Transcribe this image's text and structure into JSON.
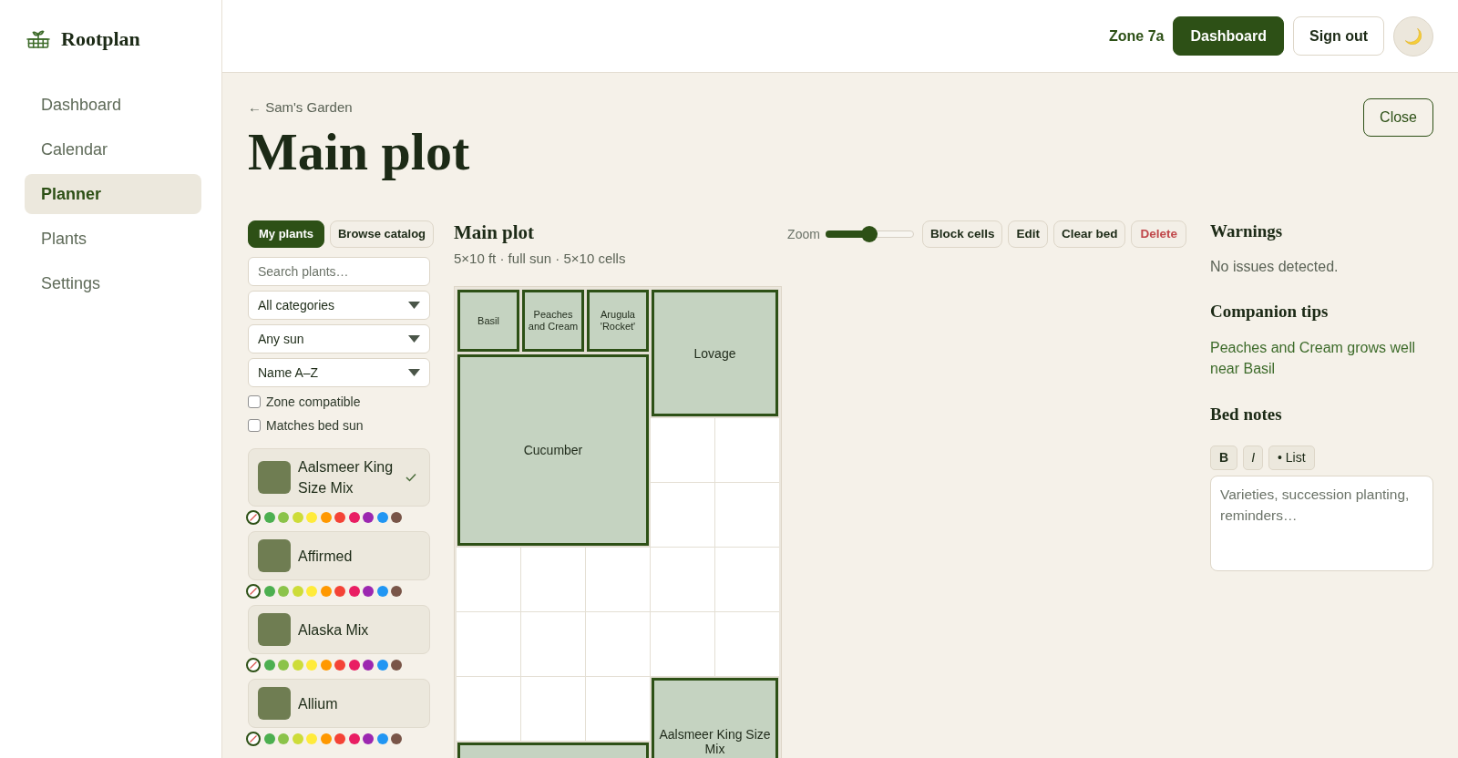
{
  "sidebar": {
    "brand": "Rootplan",
    "items": [
      {
        "label": "Dashboard",
        "selected": false
      },
      {
        "label": "Calendar",
        "selected": false
      },
      {
        "label": "Planner",
        "selected": true
      },
      {
        "label": "Plants",
        "selected": false
      },
      {
        "label": "Settings",
        "selected": false
      }
    ]
  },
  "header": {
    "zone": "Zone 7a",
    "buttons": [
      {
        "label": "Dashboard",
        "kind": "primary"
      },
      {
        "label": "Sign out",
        "kind": "outline"
      }
    ]
  },
  "page": {
    "breadcrumb": "← Sam's Garden",
    "title": "Main plot",
    "close_button": "Close"
  },
  "plant_panel": {
    "tabs": [
      {
        "label": "My plants",
        "selected": true
      },
      {
        "label": "Browse catalog",
        "selected": false
      }
    ],
    "search": {
      "placeholder": "Search plants…"
    },
    "filters": [
      {
        "value": "All categories"
      },
      {
        "value": "Any sun"
      },
      {
        "value": "Name A–Z"
      }
    ],
    "checkboxes": [
      {
        "label": "Zone compatible",
        "checked": false
      },
      {
        "label": "Matches bed sun",
        "checked": false
      }
    ],
    "plants": [
      {
        "name": "Aalsmeer King Size Mix",
        "selected": true,
        "swatches": [
          {
            "kind": "none",
            "selected": true
          },
          {
            "kind": "color",
            "color": "#4caf50",
            "selected": false
          },
          {
            "kind": "color",
            "color": "#8bc34a",
            "selected": false
          },
          {
            "kind": "color",
            "color": "#cddc39",
            "selected": false
          },
          {
            "kind": "color",
            "color": "#ffeb3b",
            "selected": false
          },
          {
            "kind": "color",
            "color": "#ff9800",
            "selected": false
          },
          {
            "kind": "color",
            "color": "#f44336",
            "selected": false
          },
          {
            "kind": "color",
            "color": "#e91e63",
            "selected": false
          },
          {
            "kind": "color",
            "color": "#9c27b0",
            "selected": false
          },
          {
            "kind": "color",
            "color": "#2196f3",
            "selected": false
          },
          {
            "kind": "color",
            "color": "#795548",
            "selected": false
          }
        ]
      },
      {
        "name": "Affirmed",
        "selected": false,
        "swatches": [
          {
            "kind": "none",
            "selected": true
          },
          {
            "kind": "color",
            "color": "#4caf50",
            "selected": false
          },
          {
            "kind": "color",
            "color": "#8bc34a",
            "selected": false
          },
          {
            "kind": "color",
            "color": "#cddc39",
            "selected": false
          },
          {
            "kind": "color",
            "color": "#ffeb3b",
            "selected": false
          },
          {
            "kind": "color",
            "color": "#ff9800",
            "selected": false
          },
          {
            "kind": "color",
            "color": "#f44336",
            "selected": false
          },
          {
            "kind": "color",
            "color": "#e91e63",
            "selected": false
          },
          {
            "kind": "color",
            "color": "#9c27b0",
            "selected": false
          },
          {
            "kind": "color",
            "color": "#2196f3",
            "selected": false
          },
          {
            "kind": "color",
            "color": "#795548",
            "selected": false
          }
        ]
      },
      {
        "name": "Alaska Mix",
        "selected": false,
        "swatches": [
          {
            "kind": "none",
            "selected": true
          },
          {
            "kind": "color",
            "color": "#4caf50",
            "selected": false
          },
          {
            "kind": "color",
            "color": "#8bc34a",
            "selected": false
          },
          {
            "kind": "color",
            "color": "#cddc39",
            "selected": false
          },
          {
            "kind": "color",
            "color": "#ffeb3b",
            "selected": false
          },
          {
            "kind": "color",
            "color": "#ff9800",
            "selected": false
          },
          {
            "kind": "color",
            "color": "#f44336",
            "selected": false
          },
          {
            "kind": "color",
            "color": "#e91e63",
            "selected": false
          },
          {
            "kind": "color",
            "color": "#9c27b0",
            "selected": false
          },
          {
            "kind": "color",
            "color": "#2196f3",
            "selected": false
          },
          {
            "kind": "color",
            "color": "#795548",
            "selected": false
          }
        ]
      },
      {
        "name": "Allium",
        "selected": false,
        "swatches": [
          {
            "kind": "none",
            "selected": true
          },
          {
            "kind": "color",
            "color": "#4caf50",
            "selected": false
          },
          {
            "kind": "color",
            "color": "#8bc34a",
            "selected": false
          },
          {
            "kind": "color",
            "color": "#cddc39",
            "selected": false
          },
          {
            "kind": "color",
            "color": "#ffeb3b",
            "selected": false
          },
          {
            "kind": "color",
            "color": "#ff9800",
            "selected": false
          },
          {
            "kind": "color",
            "color": "#f44336",
            "selected": false
          },
          {
            "kind": "color",
            "color": "#e91e63",
            "selected": false
          },
          {
            "kind": "color",
            "color": "#9c27b0",
            "selected": false
          },
          {
            "kind": "color",
            "color": "#2196f3",
            "selected": false
          },
          {
            "kind": "color",
            "color": "#795548",
            "selected": false
          }
        ]
      }
    ]
  },
  "bed": {
    "title": "Main plot",
    "subtitle": "5×10 ft · full sun · 5×10 cells",
    "zoom": {
      "label": "Zoom",
      "level": 0.5
    },
    "actions": [
      {
        "label": "Block cells",
        "kind": "default"
      },
      {
        "label": "Edit",
        "kind": "default"
      },
      {
        "label": "Clear bed",
        "kind": "default"
      },
      {
        "label": "Delete",
        "kind": "danger"
      }
    ],
    "grid": {
      "rows": [
        [
          {
            "kind": "plant",
            "name": "Basil"
          },
          {
            "kind": "plant",
            "name": "Peaches and Cream"
          },
          {
            "kind": "plant",
            "name": "Arugula 'Rocket'"
          },
          {
            "kind": "plant",
            "name": "Lovage"
          },
          {
            "kind": "left"
          }
        ],
        [
          {
            "kind": "below"
          },
          {
            "kind": "below"
          },
          {
            "kind": "below"
          },
          {
            "kind": "above"
          },
          {
            "kind": "above"
          }
        ],
        [
          {
            "kind": "right"
          },
          {
            "kind": "plant",
            "name": "Cucumber"
          },
          {
            "kind": "left"
          },
          {
            "kind": "empty"
          },
          {
            "kind": "empty"
          }
        ],
        [
          {
            "kind": "above"
          },
          {
            "kind": "above"
          },
          {
            "kind": "above"
          },
          {
            "kind": "empty"
          },
          {
            "kind": "empty"
          }
        ],
        [
          {
            "kind": "empty"
          },
          {
            "kind": "empty"
          },
          {
            "kind": "empty"
          },
          {
            "kind": "empty"
          },
          {
            "kind": "empty"
          }
        ],
        [
          {
            "kind": "empty"
          },
          {
            "kind": "empty"
          },
          {
            "kind": "empty"
          },
          {
            "kind": "empty"
          },
          {
            "kind": "empty"
          }
        ],
        [
          {
            "kind": "empty"
          },
          {
            "kind": "empty"
          },
          {
            "kind": "empty"
          },
          {
            "kind": "plant",
            "name": "Aalsmeer King Size Mix"
          },
          {
            "kind": "left"
          }
        ],
        [
          {
            "kind": "plant"
          },
          {
            "kind": "left"
          },
          {
            "kind": "left"
          },
          {
            "kind": "above"
          },
          {
            "kind": "above"
          }
        ]
      ]
    }
  },
  "side_panel": {
    "sections": [
      {
        "heading": "Warnings",
        "kind": "text",
        "text": "No issues detected."
      },
      {
        "heading": "Companion tips",
        "kind": "tips",
        "tips": [
          "Peaches and Cream grows well near Basil"
        ]
      },
      {
        "heading": "Bed notes",
        "kind": "notes",
        "format_buttons": [
          {
            "label": "B",
            "kind": "bold"
          },
          {
            "label": "I",
            "kind": "italic"
          },
          {
            "label": "• List",
            "kind": "list"
          }
        ],
        "placeholder": "Varieties, succession planting, reminders…"
      }
    ]
  }
}
